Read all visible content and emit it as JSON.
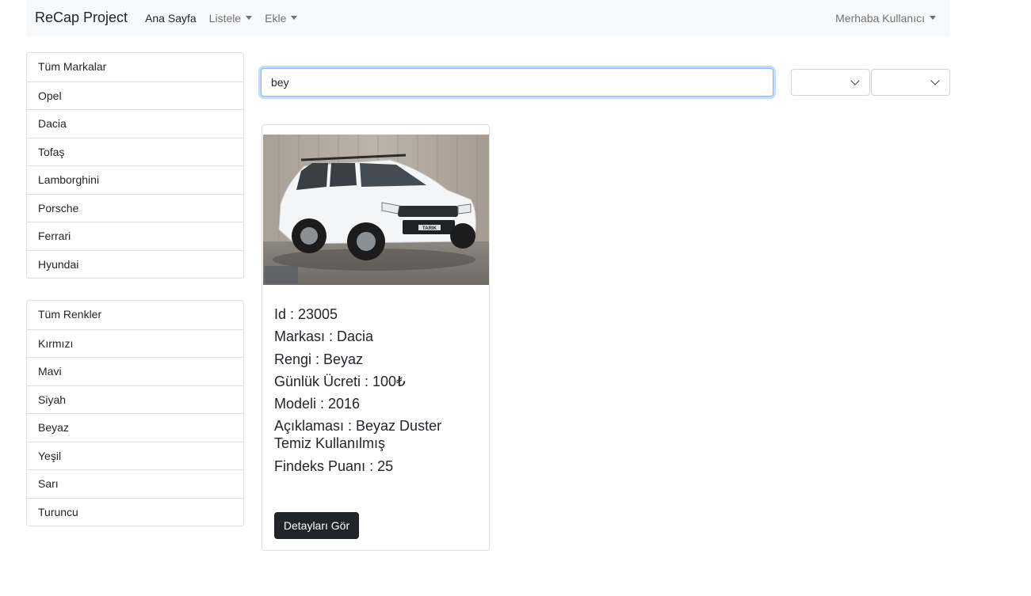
{
  "navbar": {
    "brand": "ReCap Project",
    "links": [
      {
        "label": "Ana Sayfa"
      },
      {
        "label": "Listele"
      },
      {
        "label": "Ekle"
      }
    ],
    "user_menu": "Merhaba Kullanıcı"
  },
  "brands": [
    "Tüm Markalar",
    "Opel",
    "Dacia",
    "Tofaş",
    "Lamborghini",
    "Porsche",
    "Ferrari",
    "Hyundai"
  ],
  "colors": [
    "Tüm Renkler",
    "Kırmızı",
    "Mavi",
    "Siyah",
    "Beyaz",
    "Yeşil",
    "Sarı",
    "Turuncu"
  ],
  "search": {
    "value": "bey"
  },
  "filters": {
    "brand_selected": "",
    "color_selected": ""
  },
  "car": {
    "id": "Id : 23005",
    "brand": "Markası : Dacia",
    "color": "Rengi : Beyaz",
    "daily_price": "Günlük Ücreti : 100₺",
    "model": "Modeli : 2016",
    "description": "Açıklaması : Beyaz Duster Temiz Kullanılmış",
    "findeks": "Findeks Puanı : 25",
    "plate_text": "TARIK",
    "button": "Detayları Gör"
  },
  "theme": {
    "accent": "#86b7fe",
    "dark_button": "#212529",
    "navbar_bg": "#f8f9fa"
  }
}
